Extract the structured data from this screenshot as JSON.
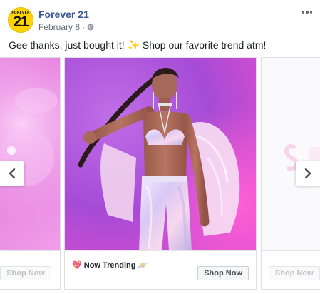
{
  "page": {
    "name": "Forever 21",
    "date": "February 8",
    "logo_top": "FOREVER",
    "logo_number": "21"
  },
  "post": {
    "text": "Gee thanks, just bought it! ✨ Shop our favorite trend atm!"
  },
  "carousel": {
    "prev_card": {
      "button_label": "Shop Now"
    },
    "main_card": {
      "headline": "💖 Now Trending 🪐",
      "button_label": "Shop Now"
    },
    "next_card": {
      "button_label": "Shop Now"
    }
  },
  "colors": {
    "brand_yellow": "#ffd200",
    "link_blue": "#385898",
    "pink_bg": "#e77ee0",
    "purple_bg": "#b24ad0"
  },
  "icons": {
    "globe": "globe-icon",
    "more": "more-options-icon",
    "prev": "chevron-left-icon",
    "next": "chevron-right-icon"
  }
}
